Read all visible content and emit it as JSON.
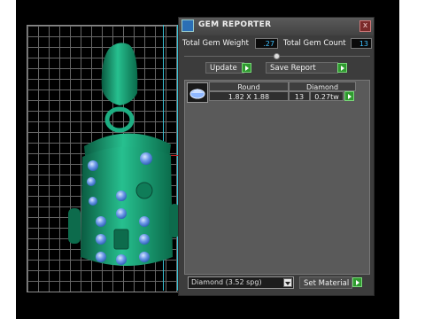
{
  "panel": {
    "title": "GEM REPORTER",
    "close_label": "x",
    "total_weight_label": "Total Gem Weight",
    "total_weight_value": ".27",
    "total_count_label": "Total Gem Count",
    "total_count_value": "13",
    "update_label": "Update",
    "save_report_label": "Save Report"
  },
  "table": {
    "columns": [
      "Round",
      "Diamond"
    ],
    "rows": [
      {
        "size": "1.82 X 1.88",
        "count": "13",
        "weight": "0.27tw"
      }
    ]
  },
  "footer": {
    "material_value": "Diamond    (3.52 spg)",
    "set_material_label": "Set Material"
  },
  "colors": {
    "jewel": "#1aa77d",
    "gem": "#4d7dd6",
    "value_text": "#3fc1ff",
    "go_button": "#2f9a2f"
  }
}
